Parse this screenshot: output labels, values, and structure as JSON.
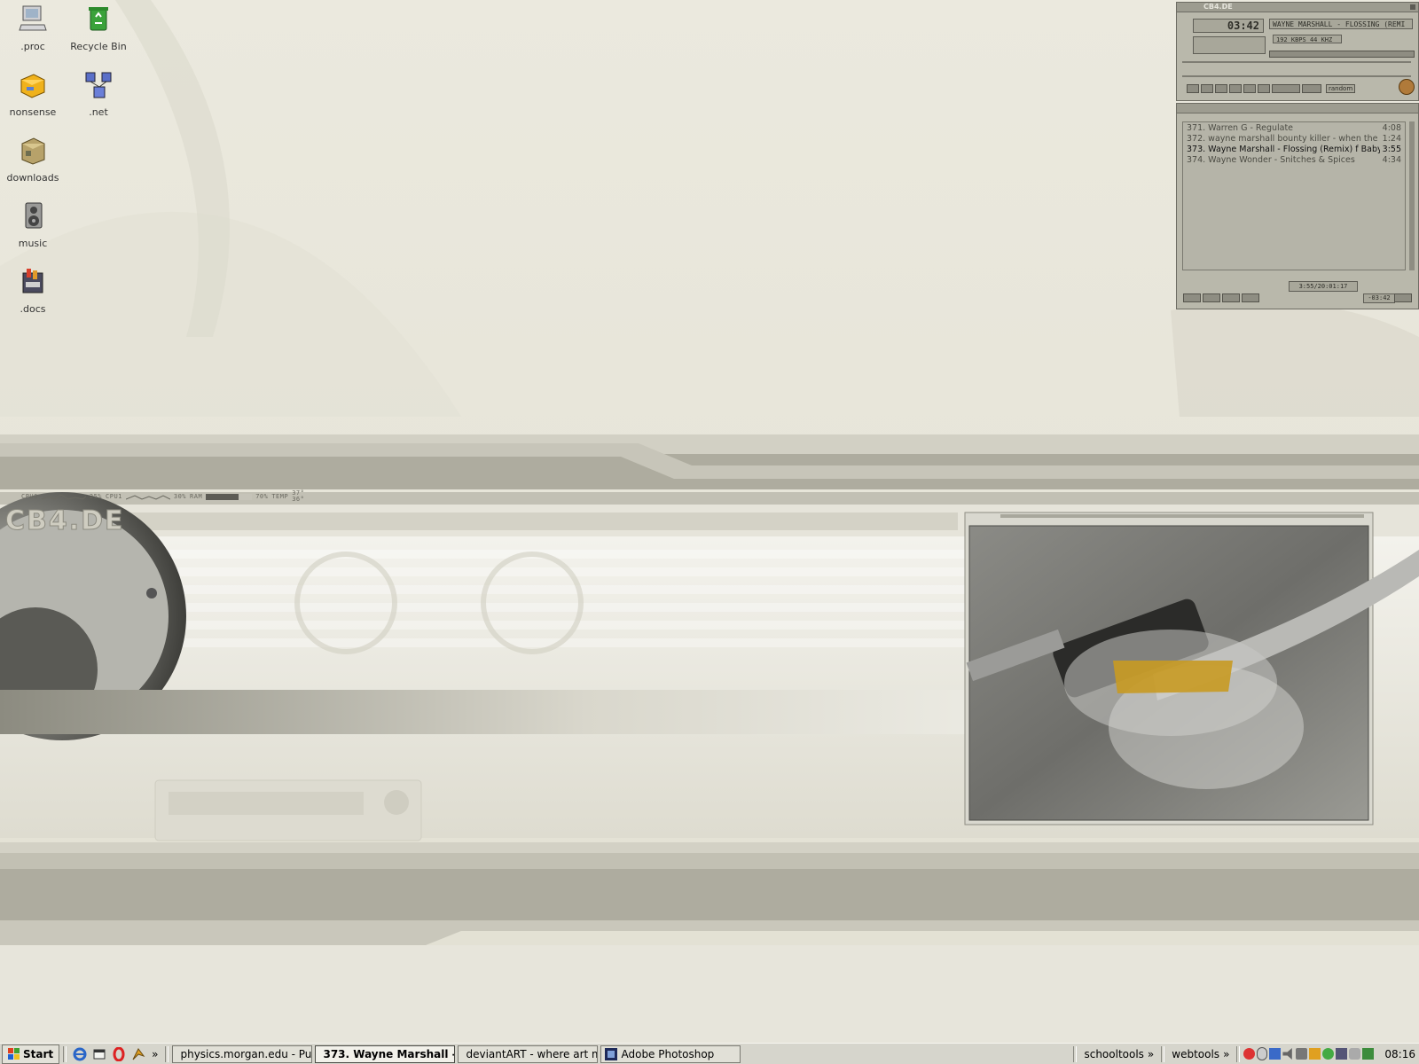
{
  "desktop": {
    "icons": [
      {
        "label": ".proc",
        "icon": "computer-icon"
      },
      {
        "label": "Recycle Bin",
        "icon": "recycle-bin-icon"
      },
      {
        "label": "nonsense",
        "icon": "briefcase-icon"
      },
      {
        "label": ".net",
        "icon": "network-icon"
      },
      {
        "label": "downloads",
        "icon": "package-icon"
      },
      {
        "label": "music",
        "icon": "speaker-icon"
      },
      {
        "label": ".docs",
        "icon": "documents-icon"
      }
    ],
    "wallpaper_logo": "CB4.DE",
    "sysmon": {
      "cpu0_label": "CPU0",
      "cpu0_value": "25%",
      "cpu1_label": "CPU1",
      "cpu1_value": "30%",
      "ram_label": "RAM",
      "ram_value": "70%",
      "temp_label": "TEMP",
      "temp_value_1": "37°",
      "temp_value_2": "36°",
      "ram_fill": 0.7
    }
  },
  "winamp": {
    "brand": "CB4.DE",
    "time": "03:42",
    "title_scroll": "WAYNE MARSHALL - FLOSSING (REMI",
    "bitrate": "192 KBPS",
    "samplerate": "44 KHZ",
    "random_label": "random",
    "playlist": [
      {
        "text": "371. Warren G - Regulate",
        "time": "4:08",
        "current": false
      },
      {
        "text": "372. wayne marshall bounty killer - when the s...",
        "time": "1:24",
        "current": false
      },
      {
        "text": "373. Wayne Marshall - Flossing (Remix) f Baby G",
        "time": "3:55",
        "current": true
      },
      {
        "text": "374. Wayne Wonder - Snitches & Spices",
        "time": "4:34",
        "current": false
      }
    ],
    "pl_total": "3:55/20:01:17",
    "pl_remaining": "-03:42"
  },
  "taskbar": {
    "start_label": "Start",
    "tasks": [
      {
        "label": "physics.morgan.edu - Pu...",
        "icon": "putty-icon",
        "active": false
      },
      {
        "label": "373. Wayne Marshall -...",
        "icon": "winamp-icon",
        "active": true
      },
      {
        "label": "deviantART - where art m...",
        "icon": "ie-icon",
        "active": false
      },
      {
        "label": "Adobe Photoshop",
        "icon": "photoshop-icon",
        "active": false
      }
    ],
    "toolbar_schooltools": "schooltools",
    "toolbar_webtools": "webtools",
    "chevron": "»",
    "clock": "08:16"
  }
}
